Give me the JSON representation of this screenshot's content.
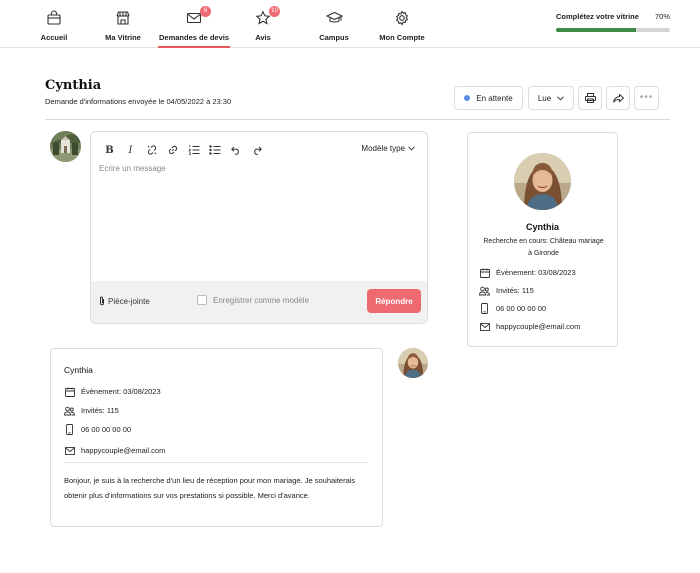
{
  "nav": {
    "items": [
      {
        "label": "Accueil",
        "icon": "shopping-bag-icon"
      },
      {
        "label": "Ma Vitrine",
        "icon": "storefront-icon"
      },
      {
        "label": "Demandes de devis",
        "icon": "envelope-icon",
        "badge": "6",
        "active": true
      },
      {
        "label": "Avis",
        "icon": "star-icon",
        "badge": "10"
      },
      {
        "label": "Campus",
        "icon": "graduation-cap-icon"
      },
      {
        "label": "Mon Compte",
        "icon": "gear-icon"
      }
    ],
    "progress": {
      "title": "Complétez votre vitrine",
      "percent_label": "70%",
      "percent": 70,
      "color": "#3f8a46"
    }
  },
  "header": {
    "name": "Cynthia",
    "subtitle": "Demande d'informations envoyée le 04/05/2022 à 23:30",
    "status_label": "En attente",
    "status_color": "#5b8ee6",
    "read_label": "Lue"
  },
  "composer": {
    "model_label": "Modèle type",
    "placeholder": "Ecrire un message",
    "attachment_label": "Pièce-jointe",
    "save_model_label": "Enregistrer comme modèle",
    "reply_label": "Répondre",
    "accent": "#ef6a70"
  },
  "profile": {
    "name": "Cynthia",
    "description": "Recherche en cours: Château mariage à Gironde",
    "event": "Évènement: 03/08/2023",
    "guests": "Invités: 115",
    "phone": "06 00 00 00 00",
    "email": "happycouple@email.com"
  },
  "message": {
    "name": "Cynthia",
    "event": "Évènement: 03/08/2023",
    "guests": "Invités: 115",
    "phone": "06 00 00 00 00",
    "email": "happycouple@email.com",
    "body": "Bonjour, je suis à la recherche d'un lieu de réception pour mon mariage. Je souhaiterais obtenir plus d'informations sur vos prestations si possible. Merci d'avance."
  }
}
